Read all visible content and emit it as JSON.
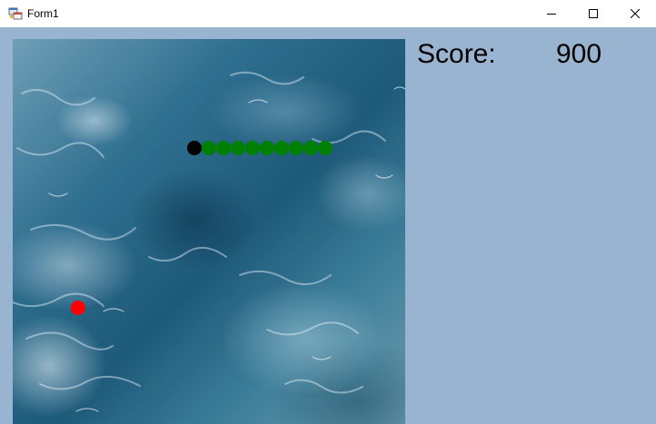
{
  "window": {
    "title": "Form1",
    "background": "#99b4d1",
    "titlebar_background": "#ffffff"
  },
  "score": {
    "label": "Score:",
    "value": "900"
  },
  "game": {
    "cell_size": 16,
    "snake": {
      "head_color": "#000000",
      "body_color": "#008000",
      "segments": [
        {
          "col": 12,
          "row": 7,
          "type": "head"
        },
        {
          "col": 13,
          "row": 7,
          "type": "body"
        },
        {
          "col": 14,
          "row": 7,
          "type": "body"
        },
        {
          "col": 15,
          "row": 7,
          "type": "body"
        },
        {
          "col": 16,
          "row": 7,
          "type": "body"
        },
        {
          "col": 17,
          "row": 7,
          "type": "body"
        },
        {
          "col": 18,
          "row": 7,
          "type": "body"
        },
        {
          "col": 19,
          "row": 7,
          "type": "body"
        },
        {
          "col": 20,
          "row": 7,
          "type": "body"
        },
        {
          "col": 21,
          "row": 7,
          "type": "body"
        }
      ]
    },
    "food": {
      "col": 4,
      "row": 18,
      "color": "#ff0000"
    }
  },
  "icons": {
    "app": "windows-form-icon",
    "minimize": "minimize-icon",
    "maximize": "maximize-icon",
    "close": "close-icon"
  }
}
